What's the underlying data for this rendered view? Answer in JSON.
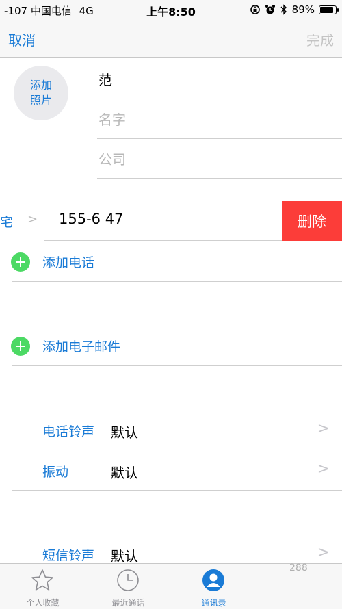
{
  "status_bar": {
    "signal": "-107",
    "carrier": "中国电信",
    "network": "4G",
    "time": "上午8:50",
    "battery_percent": "89%",
    "battery_level": 0.89
  },
  "nav": {
    "cancel_label": "取消",
    "done_label": "完成"
  },
  "contact": {
    "add_photo_line1": "添加",
    "add_photo_line2": "照片",
    "last_name": "范",
    "first_name_placeholder": "名字",
    "company_placeholder": "公司"
  },
  "phone": {
    "label_fragment": "宅",
    "number_visible": "155-6 47",
    "delete_label": "删除"
  },
  "add_phone_label": "添加电话",
  "add_email_label": "添加电子邮件",
  "settings": [
    {
      "label": "电话铃声",
      "value": "默认"
    },
    {
      "label": "振动",
      "value": "默认"
    },
    {
      "label": "短信铃声",
      "value": "默认"
    }
  ],
  "tabs": [
    {
      "label": "个人收藏",
      "icon": "star-icon"
    },
    {
      "label": "最近通话",
      "icon": "clock-icon"
    },
    {
      "label": "通讯录",
      "icon": "person-icon",
      "active": true
    },
    {
      "label": "",
      "icon": "keypad-icon",
      "badge": "288"
    }
  ],
  "colors": {
    "accent": "#1a7bd6",
    "delete": "#fc3d39",
    "add": "#4cd964"
  }
}
